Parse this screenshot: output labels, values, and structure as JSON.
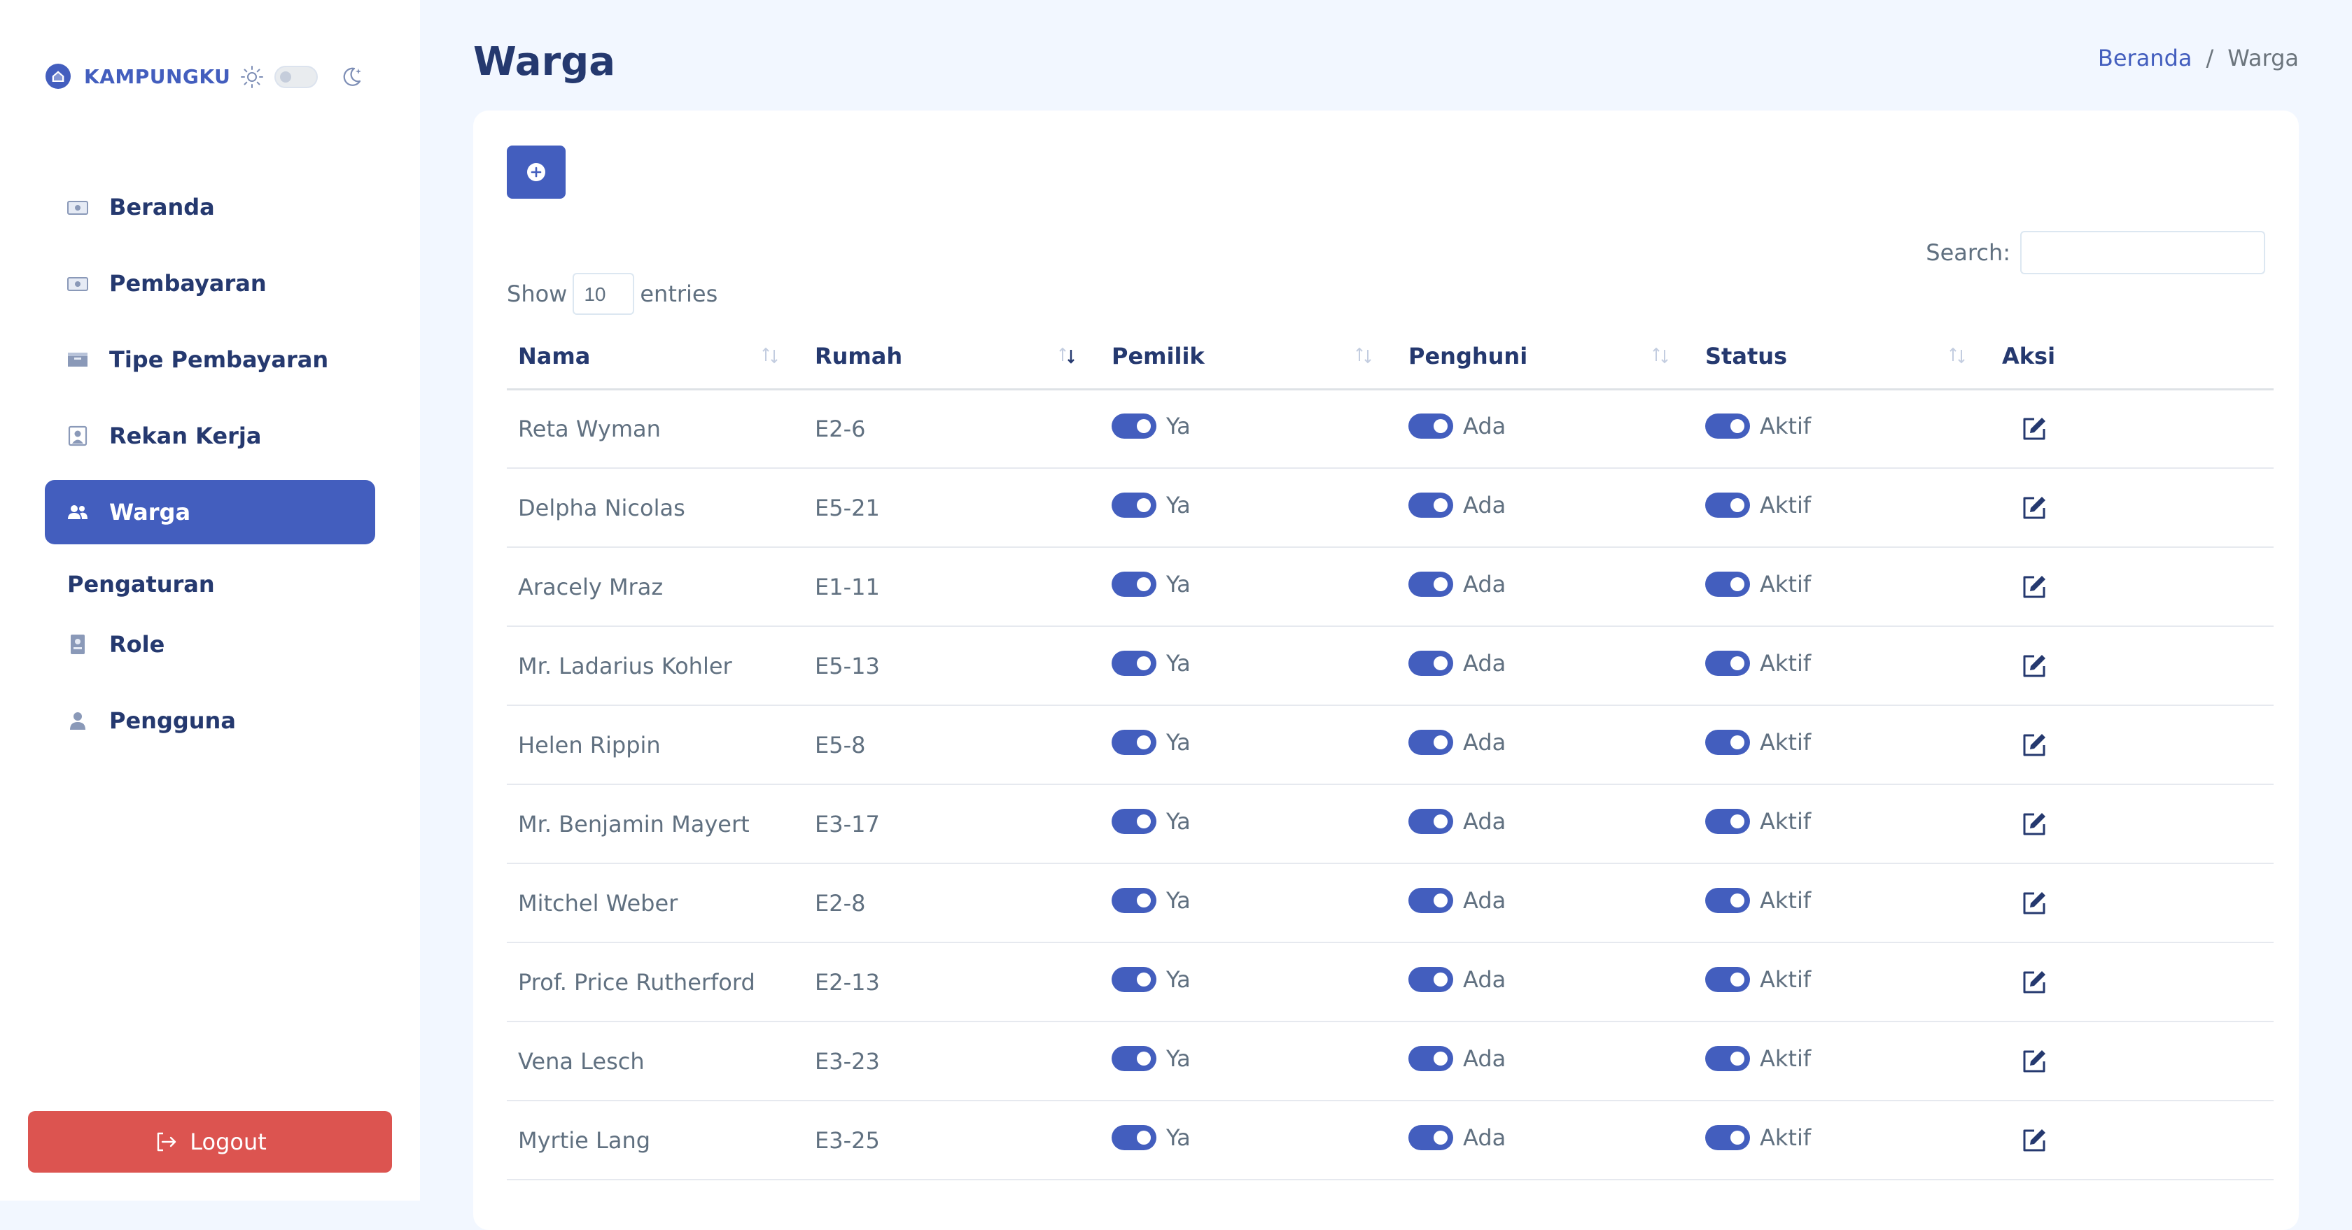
{
  "brand": {
    "name": "KAMPUNGKU",
    "logo_icon": "home-icon",
    "color": "#435ebe"
  },
  "theme": {
    "light_icon": "sun-icon",
    "dark_icon": "moon-icon",
    "dark_mode": false
  },
  "sidebar": {
    "items": [
      {
        "label": "Beranda",
        "icon": "money-icon",
        "active": false
      },
      {
        "label": "Pembayaran",
        "icon": "money-icon",
        "active": false
      },
      {
        "label": "Tipe Pembayaran",
        "icon": "wallet-icon",
        "active": false
      },
      {
        "label": "Rekan Kerja",
        "icon": "person-badge-icon",
        "active": false
      },
      {
        "label": "Warga",
        "icon": "people-icon",
        "active": true
      }
    ],
    "section_title": "Pengaturan",
    "settings_items": [
      {
        "label": "Role",
        "icon": "id-card-icon"
      },
      {
        "label": "Pengguna",
        "icon": "person-icon"
      }
    ],
    "logout_label": "Logout"
  },
  "page": {
    "title": "Warga",
    "breadcrumb": {
      "home": "Beranda",
      "separator": "/",
      "current": "Warga"
    }
  },
  "table_controls": {
    "search_label": "Search:",
    "search_value": "",
    "show_label": "Show",
    "entries_value": "10",
    "entries_label": "entries"
  },
  "table": {
    "columns": [
      "Nama",
      "Rumah",
      "Pemilik",
      "Penghuni",
      "Status",
      "Aksi"
    ],
    "sorted_column": "Rumah",
    "rows": [
      {
        "nama": "Reta Wyman",
        "rumah": "E2-6",
        "pemilik": "Ya",
        "penghuni": "Ada",
        "status": "Aktif"
      },
      {
        "nama": "Delpha Nicolas",
        "rumah": "E5-21",
        "pemilik": "Ya",
        "penghuni": "Ada",
        "status": "Aktif"
      },
      {
        "nama": "Aracely Mraz",
        "rumah": "E1-11",
        "pemilik": "Ya",
        "penghuni": "Ada",
        "status": "Aktif"
      },
      {
        "nama": "Mr. Ladarius Kohler",
        "rumah": "E5-13",
        "pemilik": "Ya",
        "penghuni": "Ada",
        "status": "Aktif"
      },
      {
        "nama": "Helen Rippin",
        "rumah": "E5-8",
        "pemilik": "Ya",
        "penghuni": "Ada",
        "status": "Aktif"
      },
      {
        "nama": "Mr. Benjamin Mayert",
        "rumah": "E3-17",
        "pemilik": "Ya",
        "penghuni": "Ada",
        "status": "Aktif"
      },
      {
        "nama": "Mitchel Weber",
        "rumah": "E2-8",
        "pemilik": "Ya",
        "penghuni": "Ada",
        "status": "Aktif"
      },
      {
        "nama": "Prof. Price Rutherford",
        "rumah": "E2-13",
        "pemilik": "Ya",
        "penghuni": "Ada",
        "status": "Aktif"
      },
      {
        "nama": "Vena Lesch",
        "rumah": "E3-23",
        "pemilik": "Ya",
        "penghuni": "Ada",
        "status": "Aktif"
      },
      {
        "nama": "Myrtie Lang",
        "rumah": "E3-25",
        "pemilik": "Ya",
        "penghuni": "Ada",
        "status": "Aktif"
      }
    ]
  },
  "colors": {
    "primary": "#435ebe",
    "danger": "#dc5450",
    "text": "#25396f",
    "muted": "#607080"
  }
}
